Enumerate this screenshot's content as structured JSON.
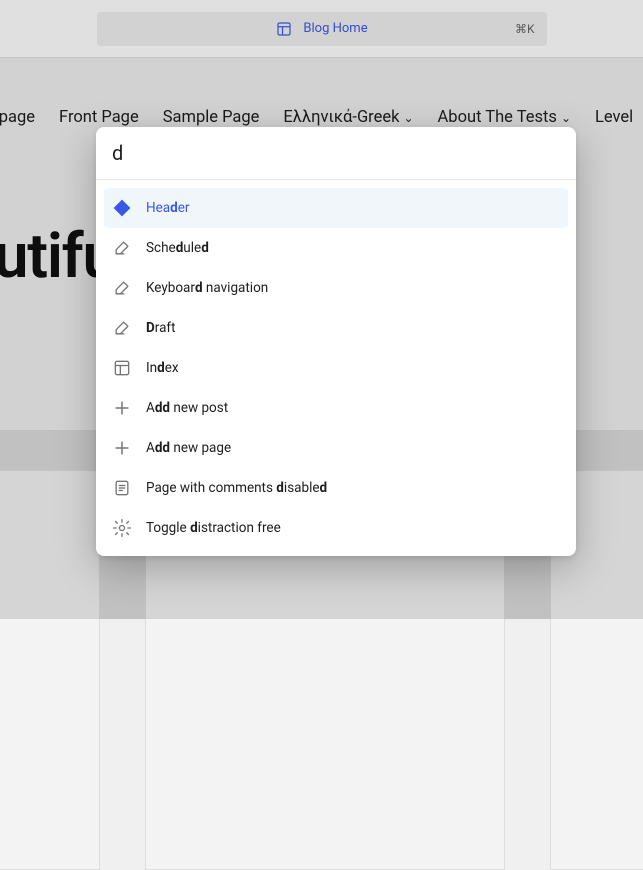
{
  "topbar": {
    "title": "Blog Home",
    "shortcut": "⌘K"
  },
  "nav": {
    "items": [
      {
        "label": "og page",
        "has_submenu": false
      },
      {
        "label": "Front Page",
        "has_submenu": false
      },
      {
        "label": "Sample Page",
        "has_submenu": false
      },
      {
        "label": "Ελληνικά-Greek",
        "has_submenu": true
      },
      {
        "label": "About The Tests",
        "has_submenu": true
      },
      {
        "label": "Level",
        "has_submenu": false
      }
    ]
  },
  "hero": {
    "text": ": a beautiful day."
  },
  "palette": {
    "query": "d",
    "items": [
      {
        "icon": "diamond-icon",
        "label_html": "Hea<b>d</b>er",
        "selected": true
      },
      {
        "icon": "compose-icon",
        "label_html": "Sche<b>d</b>ule<b>d</b>",
        "selected": false
      },
      {
        "icon": "compose-icon",
        "label_html": "Keyboar<b>d</b> navigation",
        "selected": false
      },
      {
        "icon": "compose-icon",
        "label_html": "<b>D</b>raft",
        "selected": false
      },
      {
        "icon": "layout-icon",
        "label_html": "In<b>d</b>ex",
        "selected": false
      },
      {
        "icon": "plus-icon",
        "label_html": "A<b>dd</b> new post",
        "selected": false
      },
      {
        "icon": "plus-icon",
        "label_html": "A<b>dd</b> new page",
        "selected": false
      },
      {
        "icon": "page-icon",
        "label_html": "Page with comments <b>d</b>isable<b>d</b>",
        "selected": false
      },
      {
        "icon": "gear-icon",
        "label_html": "Toggle <b>d</b>istraction free",
        "selected": false
      }
    ]
  },
  "colors": {
    "accent": "#3858e9",
    "selected_bg": "#f1f6fb"
  }
}
